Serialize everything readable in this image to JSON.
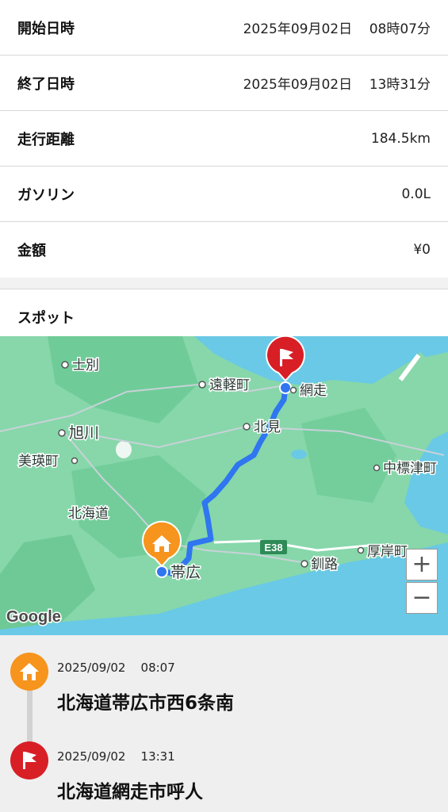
{
  "details": [
    {
      "label": "開始日時",
      "value": "2025年09月02日    08時07分"
    },
    {
      "label": "終了日時",
      "value": "2025年09月02日    13時31分"
    },
    {
      "label": "走行距離",
      "value": "184.5km"
    },
    {
      "label": "ガソリン",
      "value": "0.0L"
    },
    {
      "label": "金額",
      "value": "¥0"
    }
  ],
  "spots_heading": "スポット",
  "map": {
    "places": {
      "shibetsu": "士別",
      "engaru": "遠軽町",
      "abashiri": "網走",
      "asahikawa": "旭川",
      "kitami": "北見",
      "biei": "美瑛町",
      "nakashibetsu": "中標津町",
      "hokkaido": "北海道",
      "obihiro": "帯広",
      "kushiro": "釧路",
      "akkeshi": "厚岸町",
      "route_e38": "E38"
    },
    "attribution": "Google",
    "zoom_in": "+",
    "zoom_out": "−",
    "colors": {
      "route": "#2f76f0",
      "land": "#86d6a9",
      "sea": "#69c9e6",
      "start_marker": "#f7941d",
      "end_marker": "#d81f26"
    }
  },
  "timeline": [
    {
      "time": "2025/09/02    08:07",
      "address": "北海道帯広市西6条南",
      "icon": "home-icon"
    },
    {
      "time": "2025/09/02    13:31",
      "address": "北海道網走市呼人",
      "icon": "flag-icon"
    }
  ]
}
